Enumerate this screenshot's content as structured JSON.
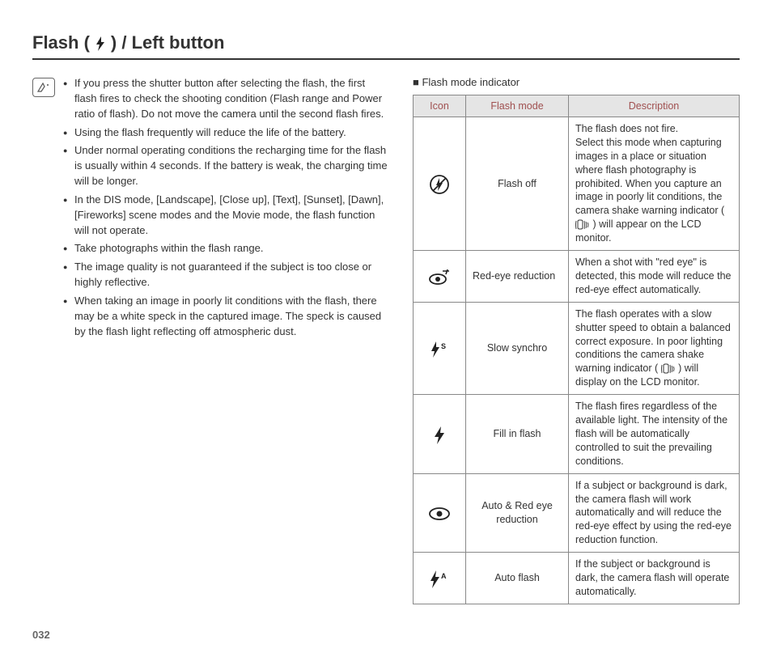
{
  "title_prefix": "Flash (",
  "title_suffix": ") / Left button",
  "bullets": [
    "If you press the shutter button after selecting the flash, the first flash fires to check the shooting condition (Flash range and Power ratio of flash). Do not move the camera until the second flash fires.",
    "Using the flash frequently will reduce the life of the battery.",
    "Under normal operating conditions the recharging time for the flash is usually within 4 seconds. If the battery is weak, the charging time will be longer.",
    "In the DIS mode, [Landscape], [Close up], [Text], [Sunset], [Dawn], [Fireworks] scene modes and the Movie mode, the flash function will not operate.",
    "Take photographs within the flash range.",
    "The image quality is not guaranteed if the subject is too close or highly reflective.",
    "When taking an image in poorly lit conditions with the flash, there may be a white speck in the captured image. The speck is caused by the flash light reflecting off atmospheric dust."
  ],
  "table_caption": "Flash mode indicator",
  "headers": {
    "icon": "Icon",
    "mode": "Flash mode",
    "desc": "Description"
  },
  "rows": [
    {
      "icon_name": "flash-off-icon",
      "mode": "Flash off",
      "desc_pre": "The flash does not fire.\nSelect this mode when capturing images in a place or situation where flash photography is prohibited. When you capture an image in poorly lit conditions, the camera shake warning indicator (",
      "desc_post": ") will appear on the LCD monitor."
    },
    {
      "icon_name": "red-eye-reduction-icon",
      "mode": "Red-eye reduction",
      "desc": "When a shot with \"red eye\" is detected, this mode will reduce the red-eye effect automatically."
    },
    {
      "icon_name": "slow-synchro-icon",
      "mode": "Slow synchro",
      "desc_pre": "The flash operates with a slow shutter speed to obtain a balanced correct exposure. In poor lighting conditions the camera shake warning indicator (",
      "desc_post": ") will display on the LCD monitor."
    },
    {
      "icon_name": "fill-in-flash-icon",
      "mode": "Fill in flash",
      "desc": "The flash fires regardless of the available light. The intensity of the flash will be automatically controlled to suit the prevailing conditions."
    },
    {
      "icon_name": "auto-red-eye-icon",
      "mode": "Auto & Red eye reduction",
      "desc": "If a subject or background is dark, the camera flash will work automatically and will reduce the red-eye effect by using the red-eye reduction function."
    },
    {
      "icon_name": "auto-flash-icon",
      "mode": "Auto flash",
      "desc": "If the subject or background is dark, the camera flash will operate automatically."
    }
  ],
  "page_number": "032"
}
